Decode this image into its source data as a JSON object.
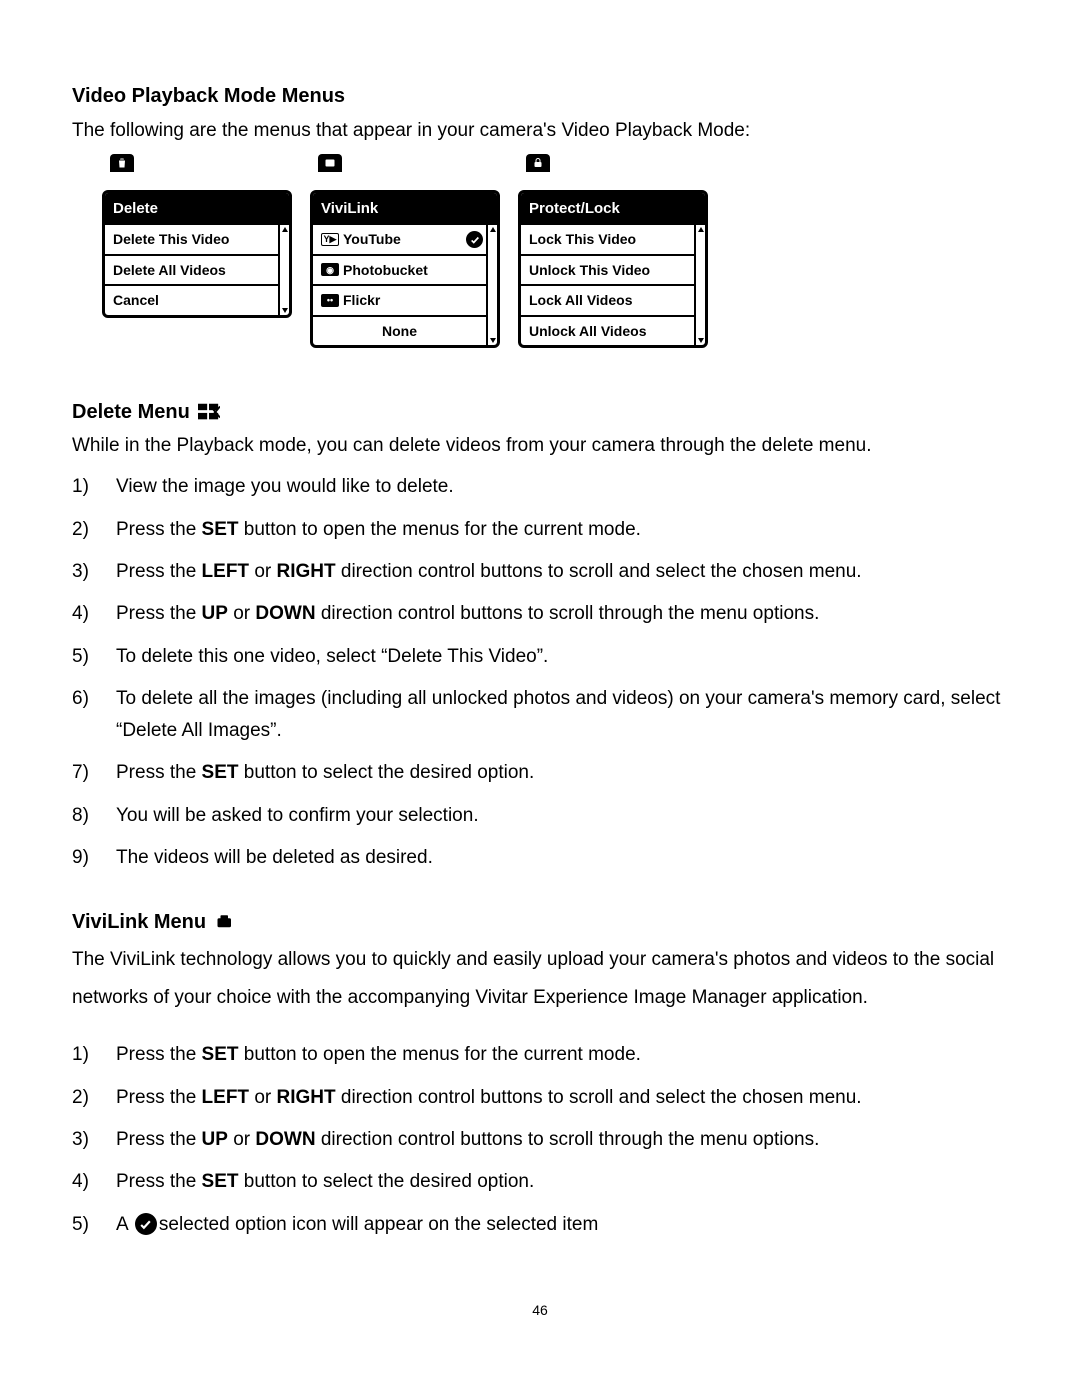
{
  "page_number": "46",
  "section1": {
    "heading": "Video Playback Mode Menus",
    "intro": "The following are the menus that appear in your camera's Video Playback Mode:"
  },
  "menus": {
    "delete": {
      "title": "Delete",
      "items": [
        "Delete This Video",
        "Delete All Videos",
        "Cancel"
      ]
    },
    "vivilink": {
      "title": "ViviLink",
      "items": [
        "YouTube",
        "Photobucket",
        "Flickr",
        "None"
      ]
    },
    "protect": {
      "title": "Protect/Lock",
      "items": [
        "Lock This Video",
        "Unlock This Video",
        "Lock All Videos",
        "Unlock All Videos"
      ]
    }
  },
  "section2": {
    "heading": "Delete Menu",
    "intro": "While in the Playback mode, you can delete videos from your camera through the delete menu.",
    "steps": {
      "s1": "View the image you would like to delete.",
      "s2_a": "Press the ",
      "s2_b": "SET",
      "s2_c": " button to open the menus for the current mode.",
      "s3_a": "Press the ",
      "s3_b": "LEFT",
      "s3_c": " or ",
      "s3_d": "RIGHT",
      "s3_e": " direction control buttons to scroll and select the chosen menu.",
      "s4_a": "Press the ",
      "s4_b": "UP",
      "s4_c": " or ",
      "s4_d": "DOWN",
      "s4_e": " direction control buttons to scroll through the menu options.",
      "s5": "To delete this one video, select “Delete This Video”.",
      "s6": "To delete all the images (including all unlocked photos and videos) on your camera's memory card, select “Delete All Images”.",
      "s7_a": "Press the ",
      "s7_b": "SET",
      "s7_c": " button to select the desired option.",
      "s8": "You will be asked to confirm your selection.",
      "s9": "The videos will be deleted as desired."
    }
  },
  "section3": {
    "heading": "ViviLink Menu",
    "intro": "The ViviLink technology allows you to quickly and easily upload your camera's photos and videos to the social networks of your choice with the accompanying Vivitar Experience Image Manager application.",
    "steps": {
      "s1_a": "Press the ",
      "s1_b": "SET",
      "s1_c": " button to open the menus for the current mode.",
      "s2_a": "Press the ",
      "s2_b": "LEFT",
      "s2_c": " or ",
      "s2_d": "RIGHT",
      "s2_e": " direction control buttons to scroll and select the chosen menu.",
      "s3_a": "Press the ",
      "s3_b": "UP",
      "s3_c": " or ",
      "s3_d": "DOWN",
      "s3_e": " direction control buttons to scroll through the menu options.",
      "s4_a": "Press the ",
      "s4_b": "SET",
      "s4_c": " button to select the desired option.",
      "s5_a": "A ",
      "s5_b": "selected option icon will appear on the selected item"
    }
  },
  "nums": {
    "n1": "1)",
    "n2": "2)",
    "n3": "3)",
    "n4": "4)",
    "n5": "5)",
    "n6": "6)",
    "n7": "7)",
    "n8": "8)",
    "n9": "9)"
  }
}
